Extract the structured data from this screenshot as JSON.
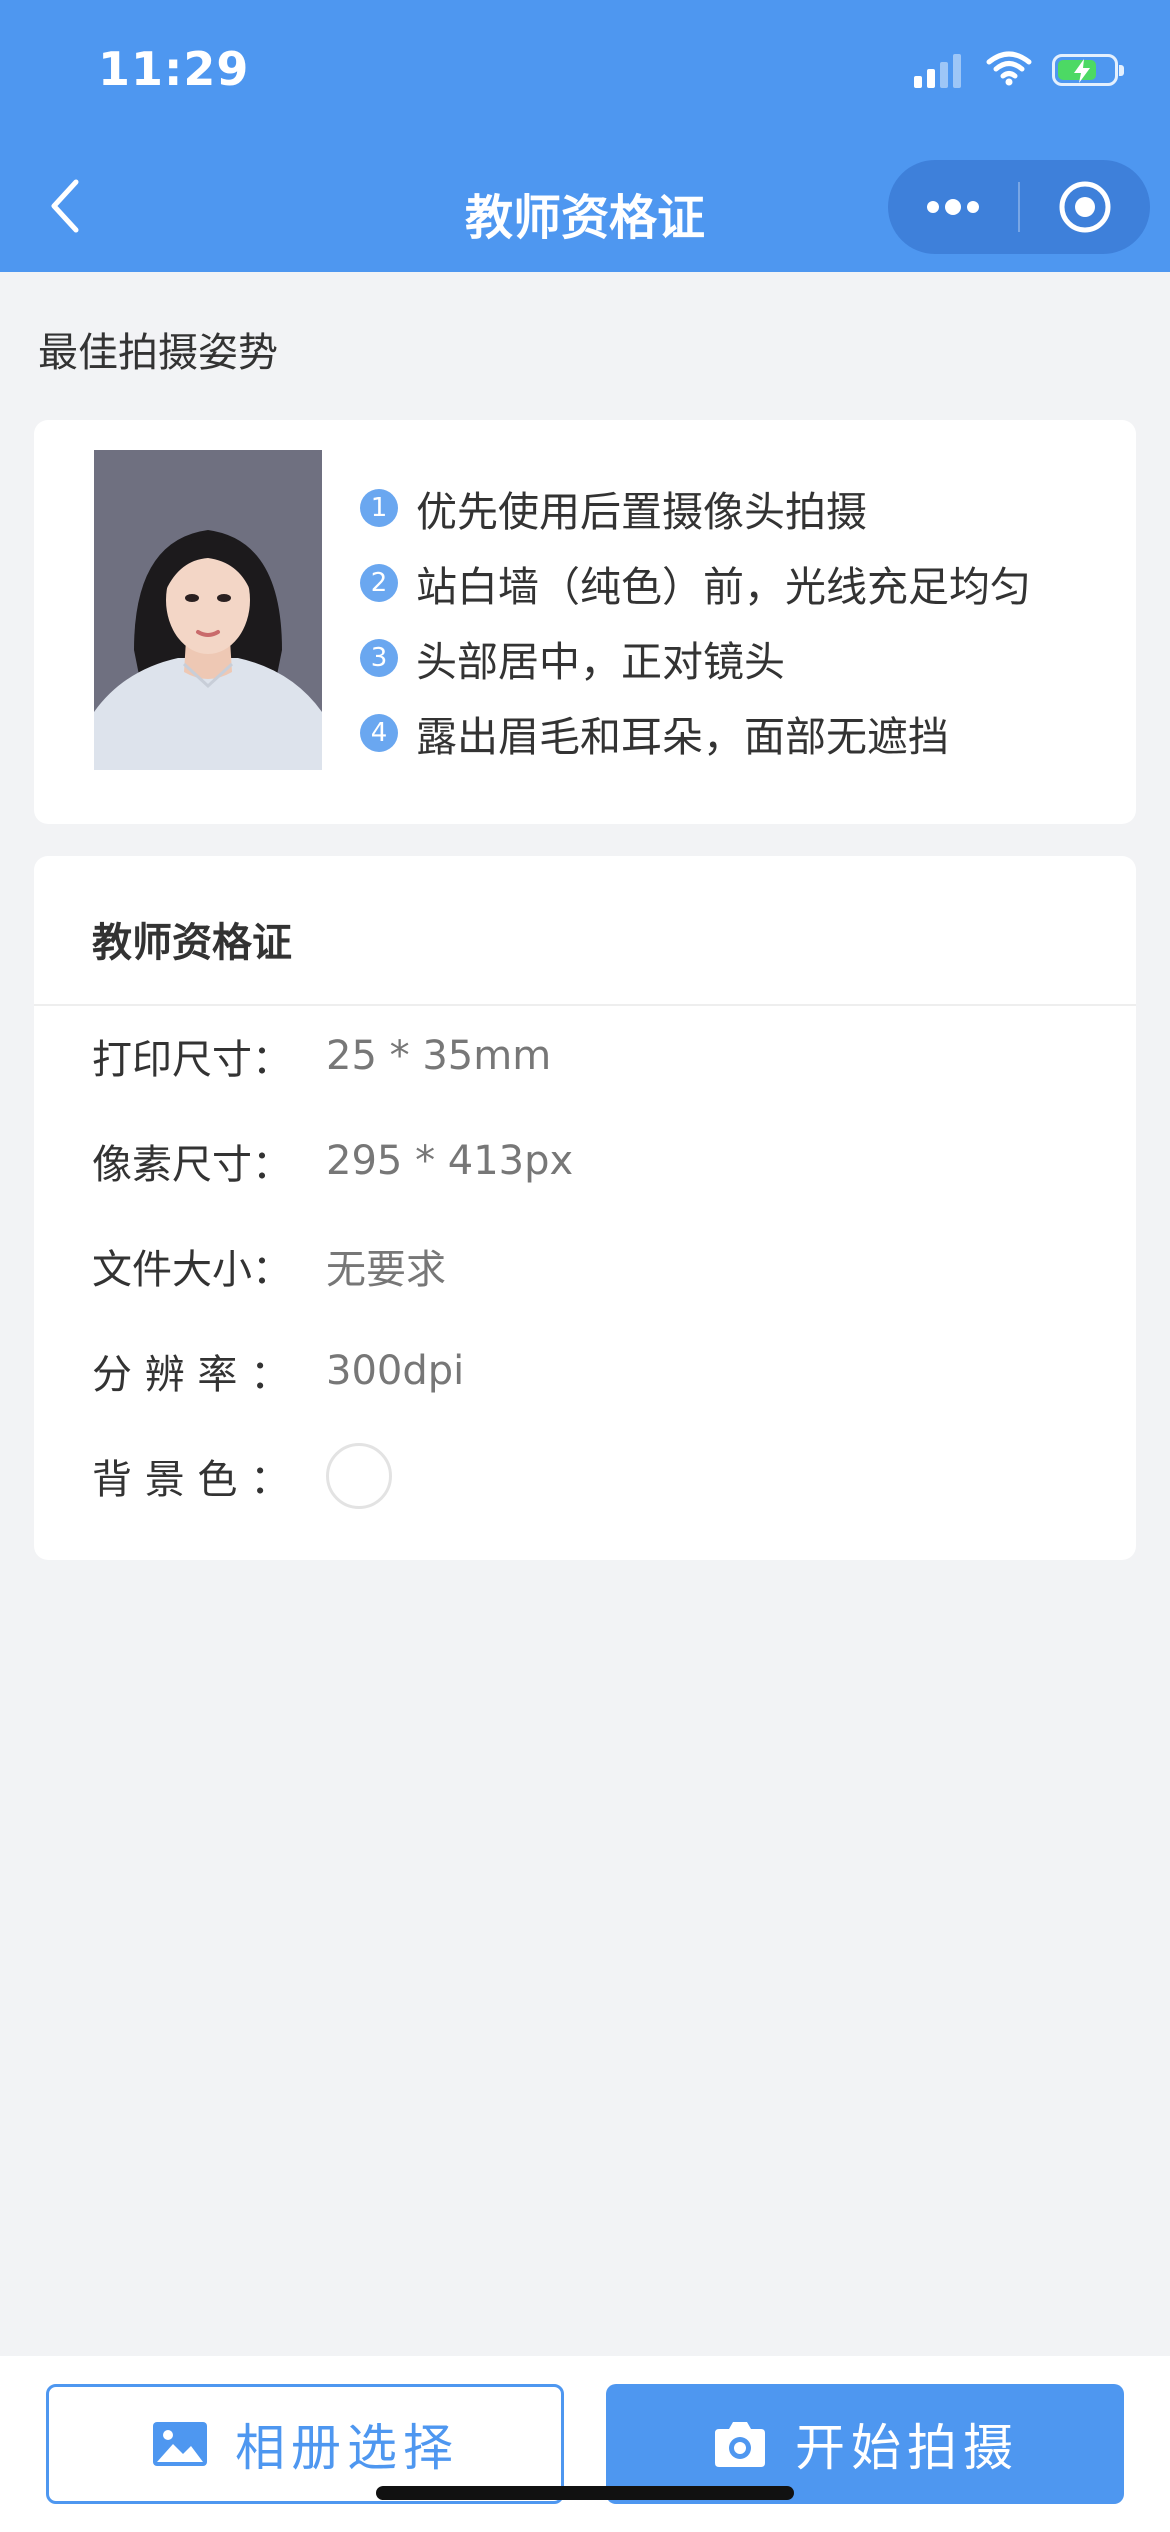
{
  "status_bar": {
    "time": "11:29"
  },
  "nav": {
    "title": "教师资格证",
    "back_icon": "chevron-left-icon",
    "more_icon": "more-dots-icon",
    "close_icon": "target-icon"
  },
  "section": {
    "label": "最佳拍摄姿势"
  },
  "tips": [
    {
      "num": "1",
      "text": "优先使用后置摄像头拍摄"
    },
    {
      "num": "2",
      "text": "站白墙（纯色）前，光线充足均匀"
    },
    {
      "num": "3",
      "text": "头部居中，正对镜头"
    },
    {
      "num": "4",
      "text": "露出眉毛和耳朵，面部无遮挡"
    }
  ],
  "spec": {
    "title": "教师资格证",
    "rows": [
      {
        "key": "打印尺寸：",
        "value": "25 * 35mm"
      },
      {
        "key": "像素尺寸：",
        "value": "295 * 413px"
      },
      {
        "key": "文件大小：",
        "value": "无要求"
      },
      {
        "key": "分 辨 率 ：",
        "value": "300dpi"
      },
      {
        "key": "背 景 色 ：",
        "value": ""
      }
    ],
    "background_color": "#ffffff"
  },
  "buttons": {
    "album": {
      "label": "相册选择",
      "icon": "image-icon"
    },
    "shoot": {
      "label": "开始拍摄",
      "icon": "camera-icon"
    }
  },
  "colors": {
    "brand": "#4e97f0",
    "page_bg": "#f2f3f5"
  }
}
